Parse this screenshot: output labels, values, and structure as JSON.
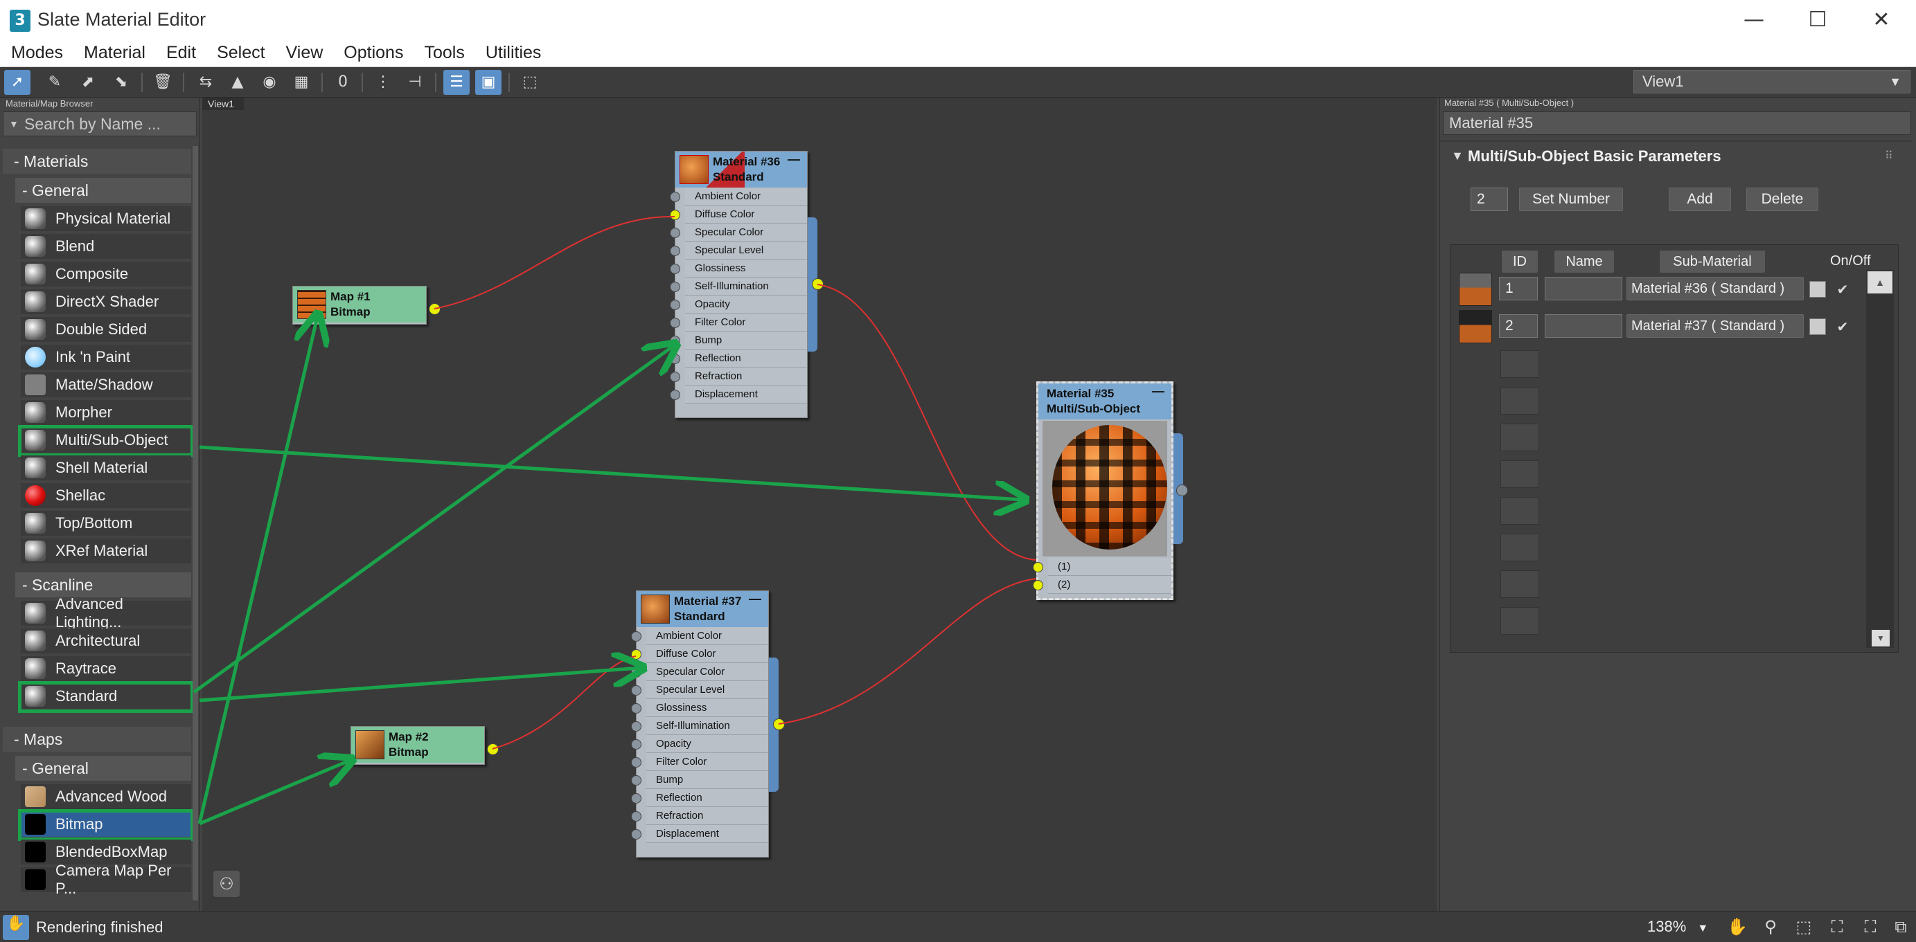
{
  "window": {
    "title": "Slate Material Editor",
    "app_icon": "3",
    "min": "—",
    "max": "☐",
    "close": "✕"
  },
  "menu": [
    "Modes",
    "Material",
    "Edit",
    "Select",
    "View",
    "Options",
    "Tools",
    "Utilities"
  ],
  "toolbar": {
    "view_select": "View1"
  },
  "browser": {
    "title": "Material/Map Browser",
    "search_placeholder": "Search by Name ...",
    "cat_materials": "- Materials",
    "sub_general": "- General",
    "materials_general": [
      "Physical Material",
      "Blend",
      "Composite",
      "DirectX Shader",
      "Double Sided",
      "Ink 'n Paint",
      "Matte/Shadow",
      "Morpher",
      "Multi/Sub-Object",
      "Shell Material",
      "Shellac",
      "Top/Bottom",
      "XRef Material"
    ],
    "sub_scanline": "- Scanline",
    "materials_scanline": [
      "Advanced Lighting...",
      "Architectural",
      "Raytrace",
      "Standard"
    ],
    "cat_maps": "- Maps",
    "sub_maps_general": "- General",
    "maps_general": [
      "Advanced Wood",
      "Bitmap",
      "BlendedBoxMap",
      "Camera Map Per P..."
    ]
  },
  "canvas": {
    "tab": "View1",
    "material36": {
      "name": "Material #36",
      "type": "Standard",
      "minimize": "—"
    },
    "material37": {
      "name": "Material #37",
      "type": "Standard",
      "minimize": "—"
    },
    "material35": {
      "name": "Material #35",
      "type": "Multi/Sub-Object",
      "minimize": "—",
      "slots": [
        "(1)",
        "(2)"
      ]
    },
    "map1": {
      "name": "Map #1",
      "type": "Bitmap"
    },
    "map2": {
      "name": "Map #2",
      "type": "Bitmap"
    },
    "standard_slots": [
      "Ambient Color",
      "Diffuse Color",
      "Specular Color",
      "Specular Level",
      "Glossiness",
      "Self-Illumination",
      "Opacity",
      "Filter Color",
      "Bump",
      "Reflection",
      "Refraction",
      "Displacement"
    ]
  },
  "params": {
    "title": "Material #35  ( Multi/Sub-Object )",
    "material_name": "Material #35",
    "rollout_title": "Multi/Sub-Object Basic Parameters",
    "count": "2",
    "set_number": "Set Number",
    "add": "Add",
    "delete": "Delete",
    "col_id": "ID",
    "col_name": "Name",
    "col_sub": "Sub-Material",
    "col_onoff": "On/Off",
    "rows": [
      {
        "id": "1",
        "name": "",
        "sub": "Material #36  ( Standard )",
        "on": "✔"
      },
      {
        "id": "2",
        "name": "",
        "sub": "Material #37  ( Standard )",
        "on": "✔"
      }
    ]
  },
  "status": {
    "text": "Rendering finished",
    "zoom": "138%"
  },
  "colors": {
    "highlight": "#1aa34a",
    "socket_active": "#e6f000",
    "wire": "#e03030",
    "material_header": "#7aa8d0",
    "map_header": "#7cc49a"
  }
}
